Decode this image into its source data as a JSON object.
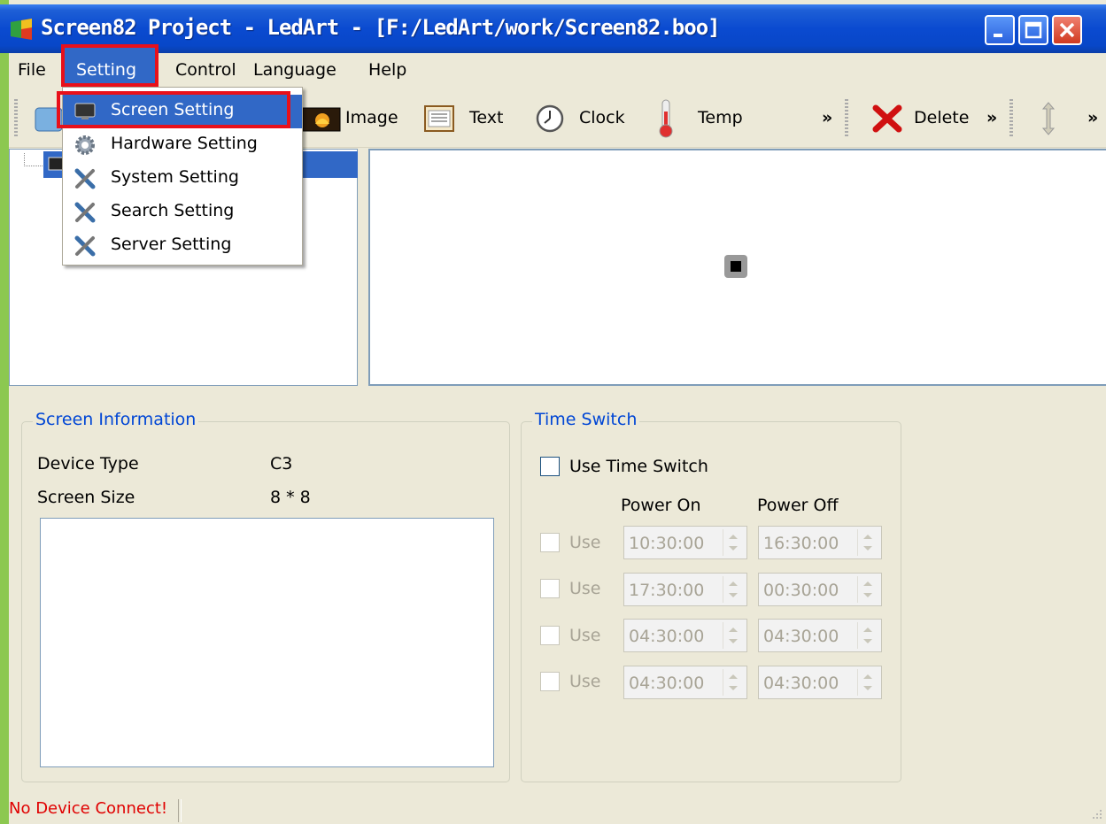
{
  "window": {
    "title": "Screen82 Project - LedArt - [F:/LedArt/work/Screen82.boo]"
  },
  "menubar": {
    "items": [
      "File",
      "Setting",
      "Control",
      "Language",
      "Help"
    ]
  },
  "setting_menu": {
    "items": [
      {
        "label": "Screen Setting",
        "icon": "monitor-icon"
      },
      {
        "label": "Hardware Setting",
        "icon": "gear-icon"
      },
      {
        "label": "System Setting",
        "icon": "tools-icon"
      },
      {
        "label": "Search Setting",
        "icon": "tools-icon"
      },
      {
        "label": "Server Setting",
        "icon": "tools-icon"
      }
    ]
  },
  "toolbar": {
    "image_label": "Image",
    "text_label": "Text",
    "clock_label": "Clock",
    "temp_label": "Temp",
    "delete_label": "Delete",
    "more": "»"
  },
  "screen_info": {
    "title": "Screen Information",
    "device_type_label": "Device Type",
    "device_type_value": "C3",
    "screen_size_label": "Screen Size",
    "screen_size_value": "8 * 8"
  },
  "time_switch": {
    "title": "Time Switch",
    "use_label": "Use Time Switch",
    "power_on_label": "Power On",
    "power_off_label": "Power Off",
    "row_label": "Use",
    "rows": [
      {
        "on": "10:30:00",
        "off": "16:30:00"
      },
      {
        "on": "17:30:00",
        "off": "00:30:00"
      },
      {
        "on": "04:30:00",
        "off": "04:30:00"
      },
      {
        "on": "04:30:00",
        "off": "04:30:00"
      }
    ]
  },
  "status": {
    "text": "No Device Connect!"
  },
  "colors": {
    "titlebar": "#0a4ad0",
    "highlight": "#3168c6",
    "annotation": "#e8101a",
    "status_error": "#e00000"
  }
}
